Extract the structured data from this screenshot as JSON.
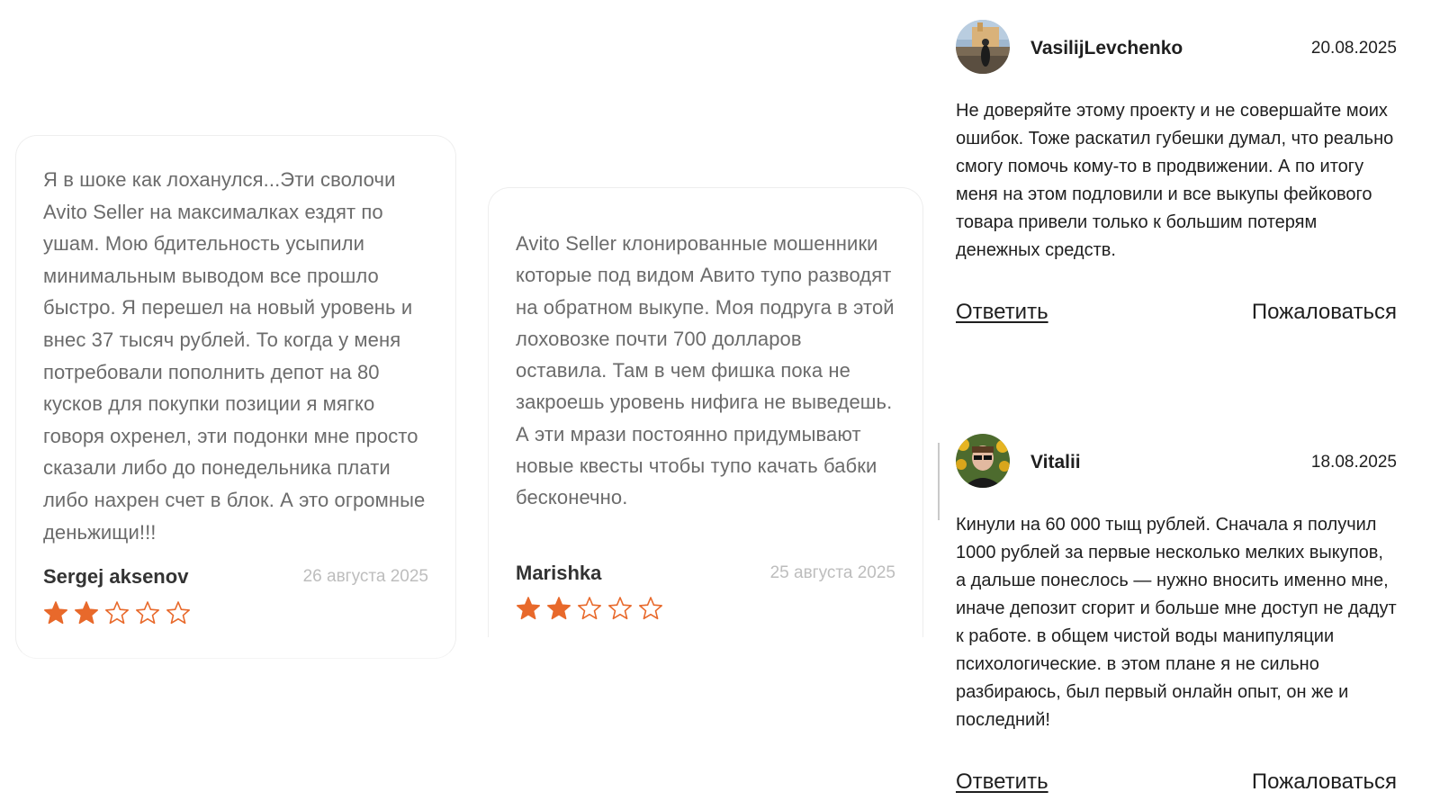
{
  "screenshot_cards": [
    {
      "text": "Я в шоке как лоханулся...Эти сволочи Avito Seller на максималках ездят по ушам. Мою бдительность усыпили минимальным выводом все прошло быстро. Я перешел на новый уровень и внес 37 тысяч рублей. То когда у меня потребовали пополнить депот на 80 кусков для покупки позиции я мягко говоря охренел, эти подонки мне просто сказали либо до понедельника плати либо нахрен счет в блок. А это огромные деньжищи!!!",
      "author": "Sergej aksenov",
      "date": "26 августа 2025",
      "rating": 2,
      "max_rating": 5
    },
    {
      "text": "Avito Seller клонированные мошенники которые под видом Авито тупо разводят на обратном выкупе. Моя подруга в этой лоховозке почти 700 долларов оставила. Там в чем фишка пока не закроешь уровень нифига не выведешь. А эти мрази постоянно придумывают новые квесты чтобы тупо качать бабки бесконечно.",
      "author": "Marishka",
      "date": "25 августа 2025",
      "rating": 2,
      "max_rating": 5
    }
  ],
  "reviews": [
    {
      "author": "VasilijLevchenko",
      "date": "20.08.2025",
      "text": "Не доверяйте этому проекту и не совершайте моих ошибок. Тоже раскатил губешки думал, что реально смогу помочь кому-то в продвижении. А по итогу меня на этом подловили и все выкупы фейкового товара привели только к большим потерям денежных средств.",
      "reply_label": "Ответить",
      "report_label": "Пожаловаться"
    },
    {
      "author": "Vitalii",
      "date": "18.08.2025",
      "text": "Кинули на 60 000 тыщ рублей. Сначала я получил 1000 рублей за первые несколько мелких выкупов, а дальше понеслось — нужно вносить именно мне, иначе депозит сгорит и больше мне доступ не дадут к работе. в общем чистой воды манипуляции психологические. в этом плане я не сильно разбираюсь, был первый онлайн опыт, он же и последний!",
      "reply_label": "Ответить",
      "report_label": "Пожаловаться"
    }
  ],
  "colors": {
    "star_filled": "#e8692b",
    "star_empty_stroke": "#e8692b"
  }
}
